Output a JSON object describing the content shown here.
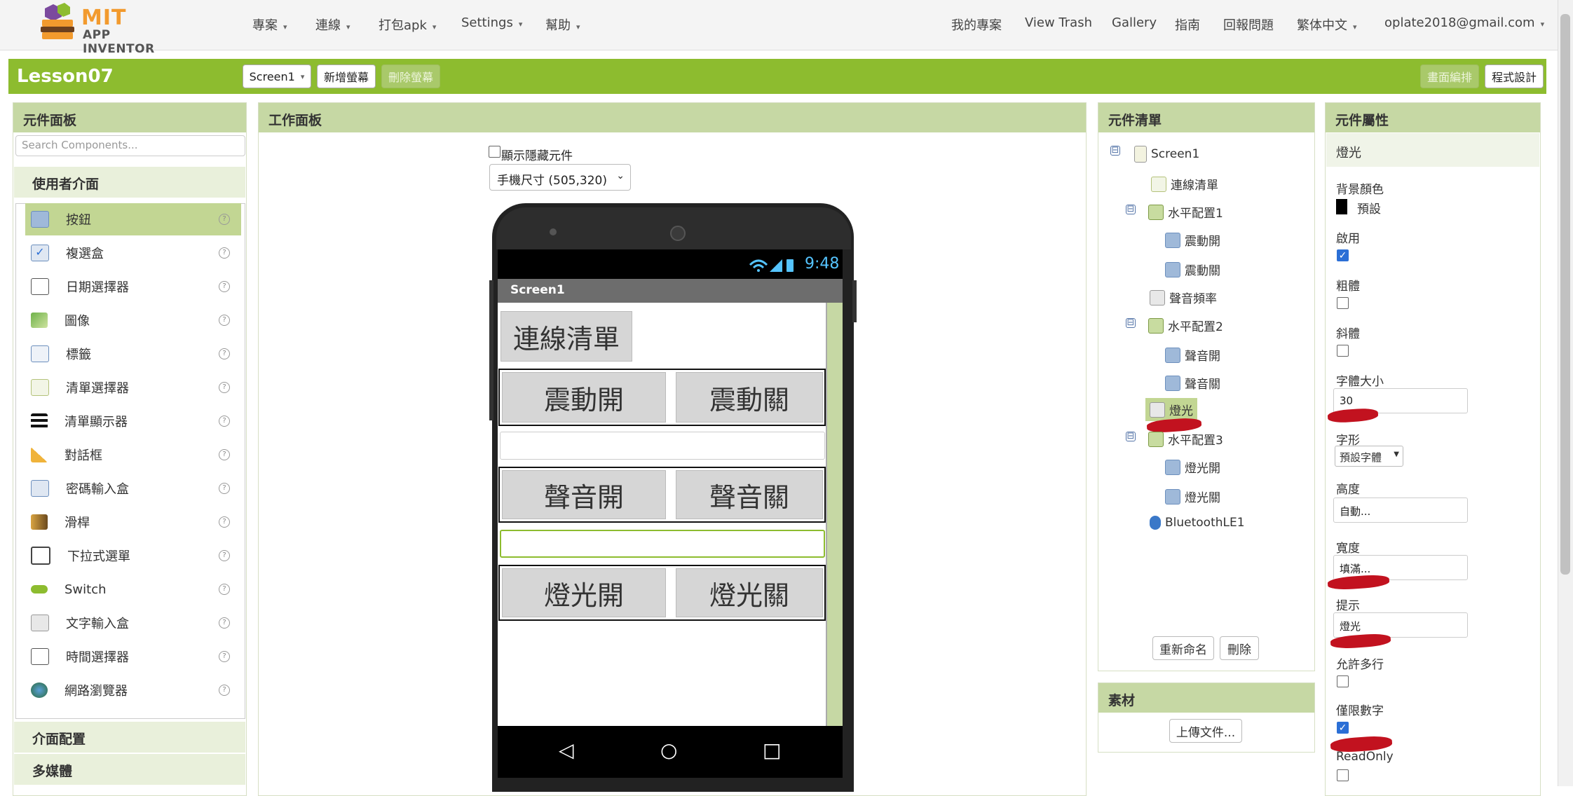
{
  "app": {
    "logo_mit": "MIT",
    "logo_sub": "APP INVENTOR"
  },
  "topnav": {
    "left": [
      "專案",
      "連線",
      "打包apk",
      "Settings",
      "幫助"
    ],
    "right": [
      "我的專案",
      "View Trash",
      "Gallery",
      "指南",
      "回報問題",
      "繁体中文",
      "oplate2018@gmail.com"
    ]
  },
  "project": {
    "name": "Lesson07",
    "screen_select": "Screen1",
    "add_screen": "新增螢幕",
    "remove_screen": "刪除螢幕",
    "designer": "畫面編排",
    "blocks": "程式設計"
  },
  "palette": {
    "title": "元件面板",
    "search_placeholder": "Search Components...",
    "category_ui": "使用者介面",
    "components": [
      "按鈕",
      "複選盒",
      "日期選擇器",
      "圖像",
      "標籤",
      "清單選擇器",
      "清單顯示器",
      "對話框",
      "密碼輸入盒",
      "滑桿",
      "下拉式選單",
      "Switch",
      "文字輸入盒",
      "時間選擇器",
      "網路瀏覽器"
    ],
    "help_glyph": "?",
    "category_layout": "介面配置",
    "category_media": "多媒體"
  },
  "viewer": {
    "title": "工作面板",
    "show_hidden": "顯示隱藏元件",
    "device": "手機尺寸 (505,320)",
    "time": "9:48",
    "screen_title": "Screen1",
    "btn_list": "連線清單",
    "btn_vib_on": "震動開",
    "btn_vib_off": "震動關",
    "btn_snd_on": "聲音開",
    "btn_snd_off": "聲音關",
    "btn_light_on": "燈光開",
    "btn_light_off": "燈光關",
    "nav_back": "◁",
    "nav_home": "○",
    "nav_recent": "□"
  },
  "tree": {
    "title": "元件清單",
    "collapse_glyph": "⊟",
    "nodes": [
      "Screen1",
      "連線清單",
      "水平配置1",
      "震動開",
      "震動關",
      "聲音頻率",
      "水平配置2",
      "聲音開",
      "聲音關",
      "燈光",
      "水平配置3",
      "燈光開",
      "燈光關",
      "BluetoothLE1"
    ],
    "rename": "重新命名",
    "delete": "刪除"
  },
  "media": {
    "title": "素材",
    "upload": "上傳文件..."
  },
  "props": {
    "title": "元件屬性",
    "component": "燈光",
    "bg_label": "背景顏色",
    "bg_value": "預設",
    "enabled_label": "啟用",
    "bold_label": "粗體",
    "italic_label": "斜體",
    "fontsize_label": "字體大小",
    "fontsize_value": "30",
    "font_label": "字形",
    "font_value": "預設字體",
    "height_label": "高度",
    "height_value": "自動...",
    "width_label": "寬度",
    "width_value": "填滿...",
    "hint_label": "提示",
    "hint_value": "燈光",
    "multiline_label": "允許多行",
    "numbers_label": "僅限數字",
    "readonly_label": "ReadOnly",
    "check_glyph": "✓"
  },
  "colors": {
    "brand_green": "#8dbc2f",
    "panel_header": "#c6d8a4",
    "annotation_red": "#c2121f"
  }
}
